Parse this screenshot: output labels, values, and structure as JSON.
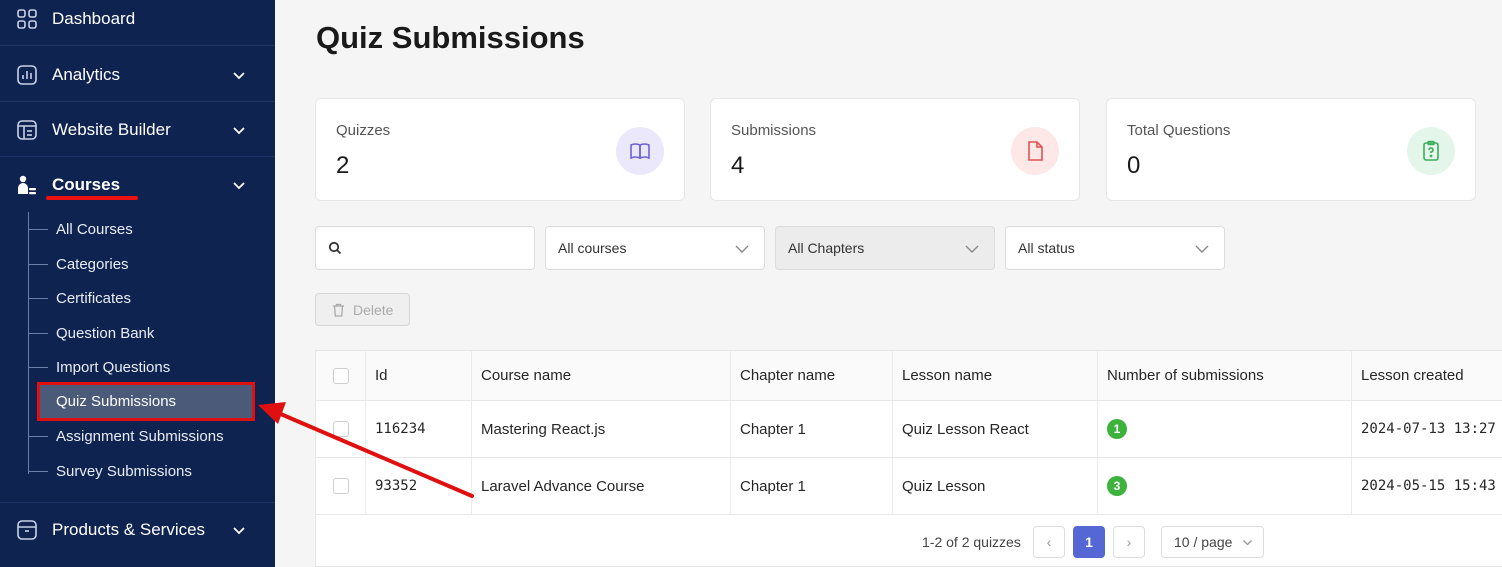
{
  "sidebar": {
    "items": [
      {
        "label": "Dashboard",
        "icon": "grid-icon"
      },
      {
        "label": "Analytics",
        "icon": "chart-icon"
      },
      {
        "label": "Website Builder",
        "icon": "layout-icon"
      },
      {
        "label": "Courses",
        "icon": "courses-icon"
      },
      {
        "label": "Products & Services",
        "icon": "box-icon"
      }
    ],
    "courses_sub": [
      {
        "label": "All Courses"
      },
      {
        "label": "Categories"
      },
      {
        "label": "Certificates"
      },
      {
        "label": "Question Bank"
      },
      {
        "label": "Import Questions"
      },
      {
        "label": "Quiz Submissions"
      },
      {
        "label": "Assignment Submissions"
      },
      {
        "label": "Survey Submissions"
      }
    ]
  },
  "page": {
    "title": "Quiz Submissions"
  },
  "stats": [
    {
      "label": "Quizzes",
      "value": "2"
    },
    {
      "label": "Submissions",
      "value": "4"
    },
    {
      "label": "Total Questions",
      "value": "0"
    }
  ],
  "filters": {
    "search_placeholder": "",
    "course": "All courses",
    "chapter": "All Chapters",
    "status": "All status"
  },
  "toolbar": {
    "delete_label": "Delete"
  },
  "table": {
    "headers": [
      "Id",
      "Course name",
      "Chapter name",
      "Lesson name",
      "Number of submissions",
      "Lesson created"
    ],
    "rows": [
      {
        "id": "116234",
        "course": "Mastering React.js",
        "chapter": "Chapter 1",
        "lesson": "Quiz Lesson React",
        "submissions": "1",
        "created": "2024-07-13 13:27"
      },
      {
        "id": "93352",
        "course": "Laravel Advance Course",
        "chapter": "Chapter 1",
        "lesson": "Quiz Lesson",
        "submissions": "3",
        "created": "2024-05-15 15:43"
      }
    ]
  },
  "pagination": {
    "total": "1-2 of 2 quizzes",
    "current_page": "1",
    "prev": "‹",
    "next": "›",
    "page_size": "10 / page"
  },
  "colors": {
    "sidebar_bg": "#0f2350",
    "highlight_red": "#e01010",
    "badge_green": "#3db33d",
    "page_active": "#5567d4"
  }
}
